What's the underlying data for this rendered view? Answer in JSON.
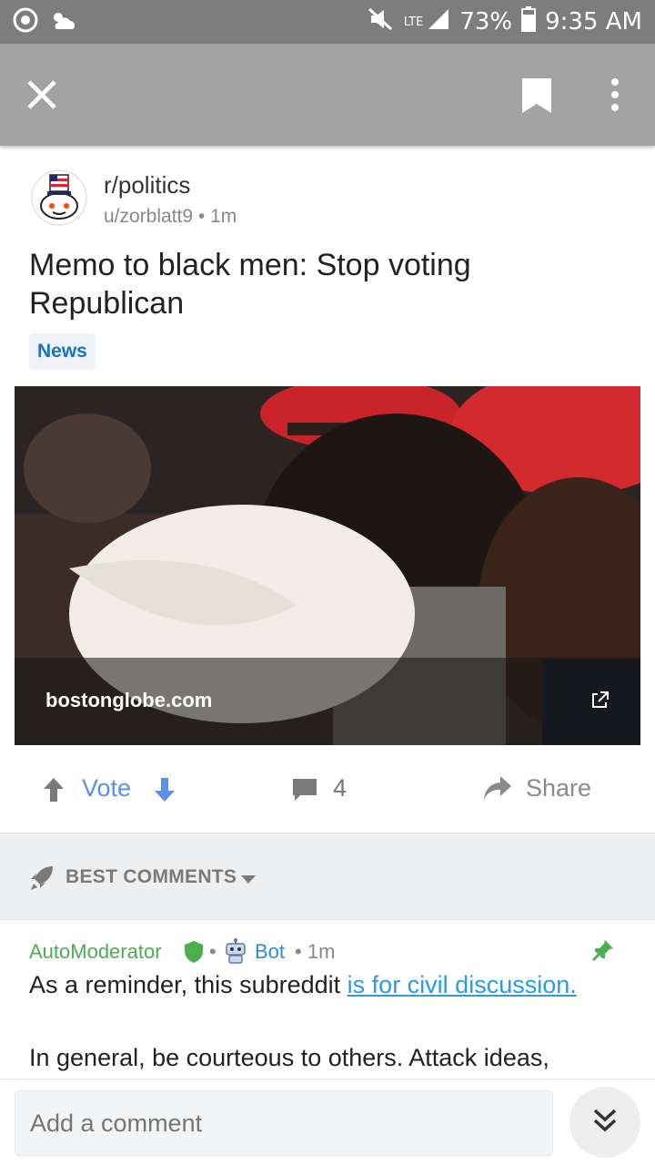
{
  "status_bar": {
    "network": "LTE",
    "battery": "73%",
    "time": "9:35 AM",
    "icons": [
      "chrome-icon",
      "weather-icon",
      "mute-icon",
      "signal-icon",
      "battery-icon"
    ]
  },
  "app_bar": {
    "icons": [
      "close-icon",
      "bookmark-icon",
      "more-vertical-icon"
    ]
  },
  "post": {
    "subreddit": "r/politics",
    "author": "u/zorblatt9",
    "separator": "•",
    "age": "1m",
    "title": "Memo to black men: Stop voting Republican",
    "flair": "News",
    "link_domain": "bostonglobe.com"
  },
  "actions": {
    "vote_label": "Vote",
    "comment_count": "4",
    "share_label": "Share"
  },
  "comments_section": {
    "sort_label": "BEST COMMENTS"
  },
  "comment": {
    "author": "AutoModerator",
    "separator": "•",
    "badge": "Bot",
    "age": "1m",
    "body_prefix": "As a reminder, this subreddit ",
    "body_link": "is for civil discussion.",
    "body_para2": "In general, be courteous to others. Attack ideas,"
  },
  "composer": {
    "placeholder": "Add a comment"
  },
  "colors": {
    "status_bar": "#7d7d7d",
    "app_bar": "#a3a3a3",
    "vote_blue": "#5d8fe6",
    "mod_green": "#4cae4f",
    "link_blue": "#2a9de2",
    "flair_text": "#1a73c8"
  }
}
